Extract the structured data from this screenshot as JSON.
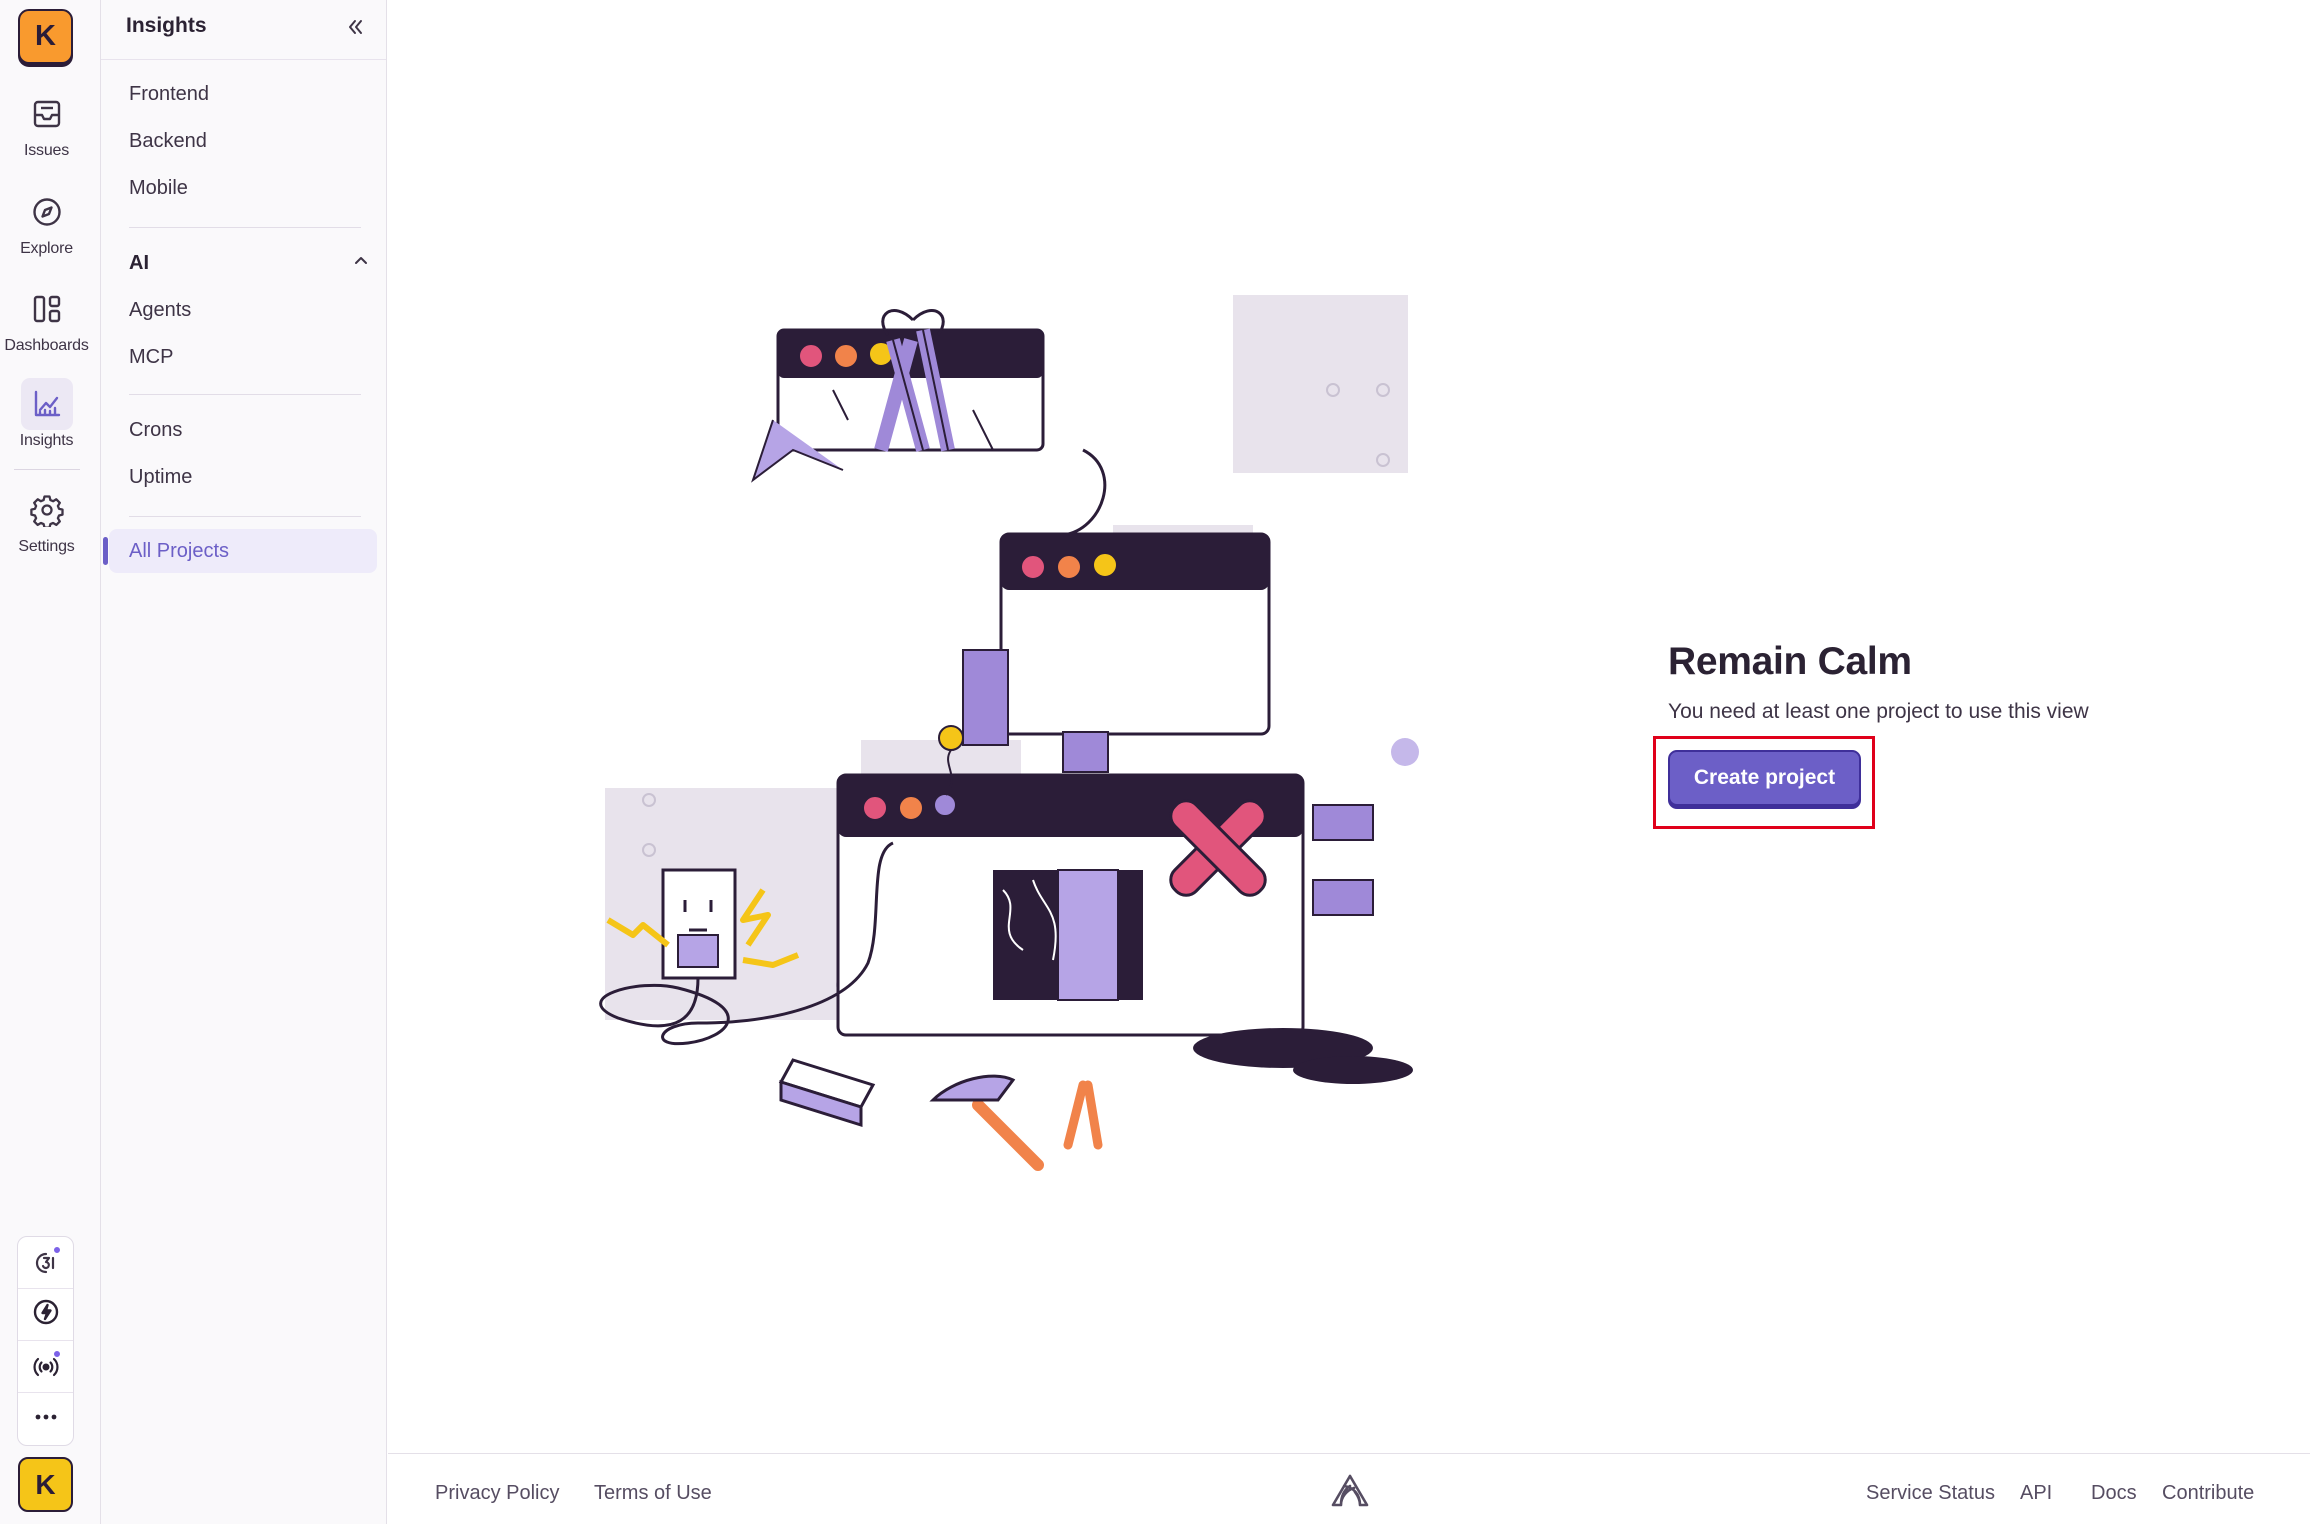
{
  "org": {
    "initial": "K"
  },
  "rail": {
    "items": [
      {
        "label": "Issues",
        "icon": "inbox-icon"
      },
      {
        "label": "Explore",
        "icon": "compass-icon"
      },
      {
        "label": "Dashboards",
        "icon": "dashboard-icon"
      },
      {
        "label": "Insights",
        "icon": "chart-icon"
      },
      {
        "label": "Settings",
        "icon": "gear-icon"
      }
    ],
    "bottom": {
      "whats_new_icon": "whats-new-icon",
      "quick_start_icon": "lightning-icon",
      "service_incidents_icon": "broadcast-icon",
      "more_icon": "ellipsis-icon"
    },
    "user_initial": "K"
  },
  "sidebar": {
    "title": "Insights",
    "links_top": [
      "Frontend",
      "Backend",
      "Mobile"
    ],
    "ai_section": {
      "title": "AI",
      "links": [
        "Agents",
        "MCP"
      ]
    },
    "links_mid": [
      "Crons",
      "Uptime"
    ],
    "all_projects": "All Projects"
  },
  "main": {
    "title": "Remain Calm",
    "subtitle": "You need at least one project to use this view",
    "create_button": "Create project"
  },
  "footer": {
    "privacy": "Privacy Policy",
    "terms": "Terms of Use",
    "service_status": "Service Status",
    "api": "API",
    "docs": "Docs",
    "contribute": "Contribute"
  },
  "colors": {
    "accent": "#6c5fc7",
    "org_badge": "#f99a2e",
    "user_badge": "#f5c518",
    "highlight": "#e0001a"
  }
}
